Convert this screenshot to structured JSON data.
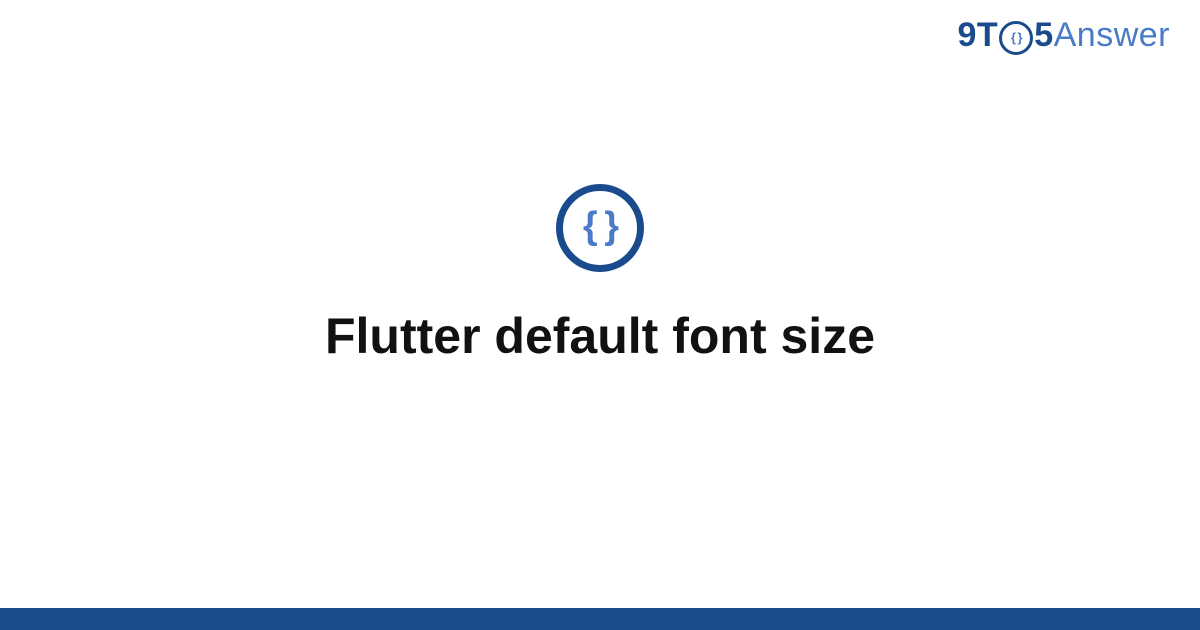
{
  "brand": {
    "part1": "9",
    "part2": "T",
    "o_inner": "{ }",
    "part3": "5",
    "part4": "Answer"
  },
  "main": {
    "category_icon_glyph": "{ }",
    "title": "Flutter default font size"
  },
  "colors": {
    "dark_blue": "#1a4b8c",
    "light_blue": "#4a7bc8",
    "background": "#ffffff"
  }
}
